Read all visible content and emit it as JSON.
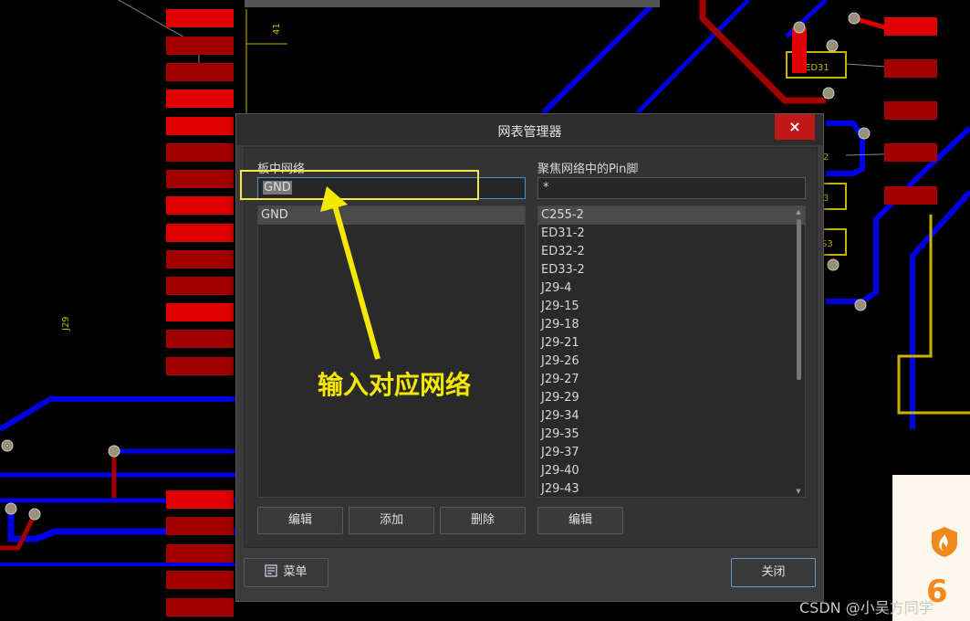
{
  "background": {
    "designators": {
      "d1": "41",
      "d2": "J29",
      "p1": "ED31",
      "p2": "2",
      "p3": "3",
      "p4": "S3"
    }
  },
  "dialog": {
    "title": "网表管理器",
    "close_glyph": "×",
    "left_panel": {
      "label": "板中网络",
      "filter_value": "GND",
      "items": [
        "GND"
      ],
      "buttons": {
        "edit": "编辑",
        "add": "添加",
        "delete": "删除"
      }
    },
    "right_panel": {
      "label": "聚焦网络中的Pin脚",
      "filter_value": "*",
      "items": [
        "C255-2",
        "ED31-2",
        "ED32-2",
        "ED33-2",
        "J29-4",
        "J29-15",
        "J29-18",
        "J29-21",
        "J29-26",
        "J29-27",
        "J29-29",
        "J29-34",
        "J29-35",
        "J29-37",
        "J29-40",
        "J29-43"
      ],
      "buttons": {
        "edit": "编辑"
      }
    },
    "footer": {
      "menu": "菜单",
      "close": "关闭"
    }
  },
  "annotation": {
    "text": "输入对应网络",
    "color": "#f5e800"
  },
  "watermark": "CSDN @小吴方同学",
  "colors": {
    "pad_red": "#e00000",
    "track_blue": "#0000e6",
    "track_red": "#a30000",
    "silk_yellow": "#c8b400",
    "accent": "#4a90d9"
  }
}
